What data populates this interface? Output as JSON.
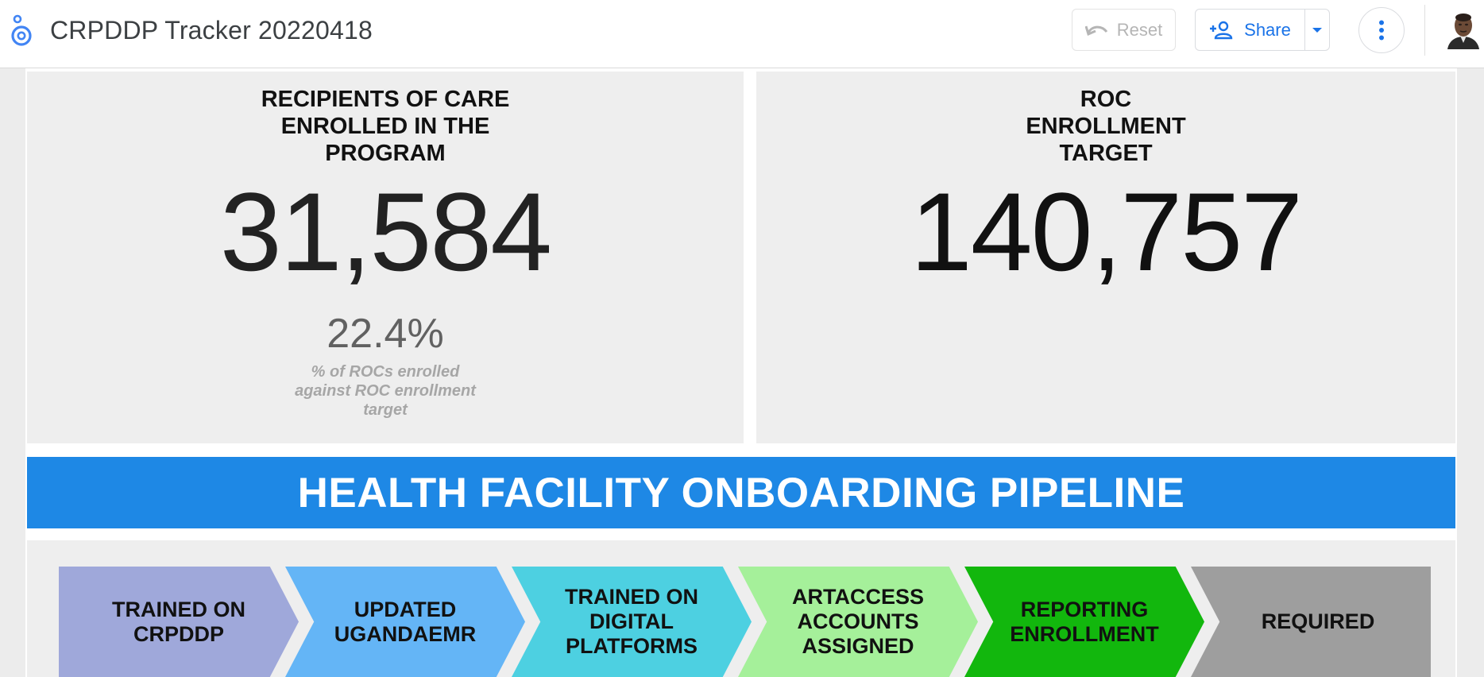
{
  "app": {
    "title": "CRPDDP Tracker 20220418",
    "logo_icon": "looker-studio-logo-icon"
  },
  "toolbar": {
    "reset_label": "Reset",
    "share_label": "Share",
    "reset_icon": "undo-icon",
    "share_icon": "person-add-icon",
    "dropdown_icon": "caret-down-icon",
    "more_icon": "more-vert-icon"
  },
  "colors": {
    "accent": "#1a73e8",
    "banner": "#1e88e5"
  },
  "kpis": {
    "enrolled": {
      "heading": "RECIPIENTS OF CARE ENROLLED IN THE PROGRAM",
      "value": "31,584",
      "percent": "22.4%",
      "note": "% of ROCs enrolled against ROC enrollment target"
    },
    "target": {
      "heading": "ROC ENROLLMENT TARGET",
      "value": "140,757"
    }
  },
  "pipeline": {
    "banner": "HEALTH FACILITY ONBOARDING PIPELINE",
    "stages": [
      {
        "label": "TRAINED ON CRPDDP",
        "color": "#9fa8da"
      },
      {
        "label": "UPDATED UGANDAEMR",
        "color": "#64b5f6"
      },
      {
        "label": "TRAINED ON DIGITAL PLATFORMS",
        "color": "#4dd0e1"
      },
      {
        "label": "ARTACCESS ACCOUNTS ASSIGNED",
        "color": "#a5f09a"
      },
      {
        "label": "REPORTING ENROLLMENT",
        "color": "#12b70d"
      },
      {
        "label": "REQUIRED",
        "color": "#9e9e9e"
      }
    ]
  }
}
